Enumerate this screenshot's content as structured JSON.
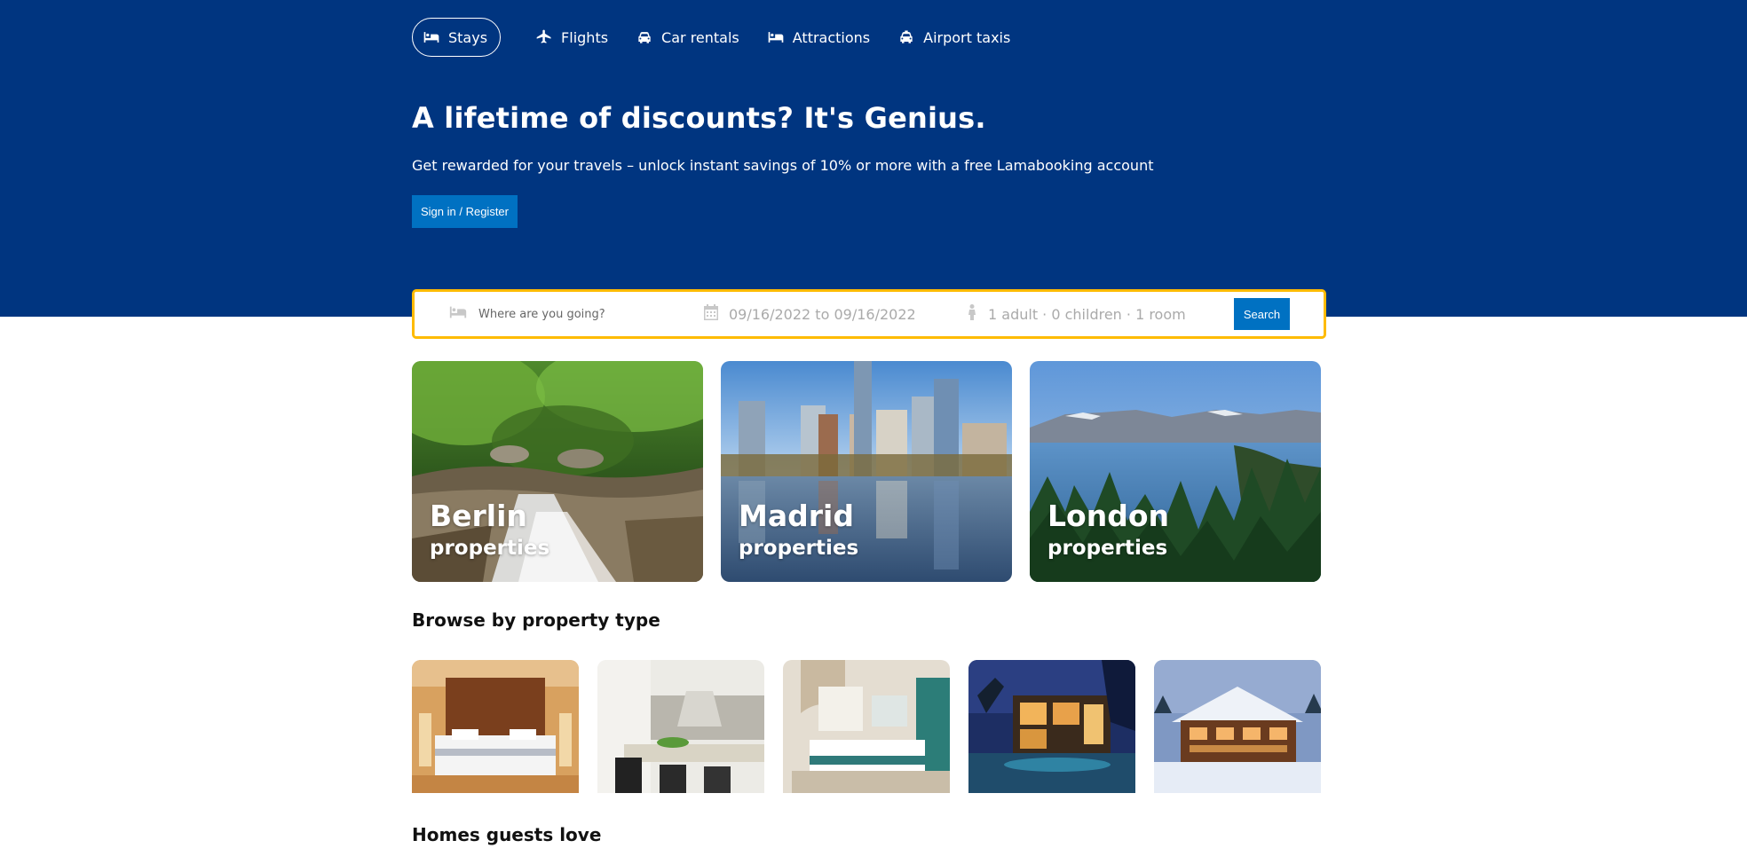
{
  "nav": {
    "items": [
      {
        "label": "Stays",
        "icon": "bed-icon",
        "active": true
      },
      {
        "label": "Flights",
        "icon": "plane-icon",
        "active": false
      },
      {
        "label": "Car rentals",
        "icon": "car-icon",
        "active": false
      },
      {
        "label": "Attractions",
        "icon": "bed-icon",
        "active": false
      },
      {
        "label": "Airport taxis",
        "icon": "taxi-icon",
        "active": false
      }
    ]
  },
  "hero": {
    "title": "A lifetime of discounts? It's Genius.",
    "subtitle": "Get rewarded for your travels – unlock instant savings of 10% or more with a free Lamabooking account",
    "signin_label": "Sign in / Register"
  },
  "search": {
    "destination_placeholder": "Where are you going?",
    "dates": "09/16/2022 to 09/16/2022",
    "guests": "1 adult · 0 children · 1 room",
    "button_label": "Search"
  },
  "featured": [
    {
      "city": "Berlin",
      "label": "properties"
    },
    {
      "city": "Madrid",
      "label": "properties"
    },
    {
      "city": "London",
      "label": "properties"
    }
  ],
  "sections": {
    "browse_title": "Browse by property type",
    "homes_title": "Homes guests love"
  },
  "colors": {
    "brand_blue": "#003580",
    "button_blue": "#0071c2",
    "search_border": "#febb02"
  }
}
